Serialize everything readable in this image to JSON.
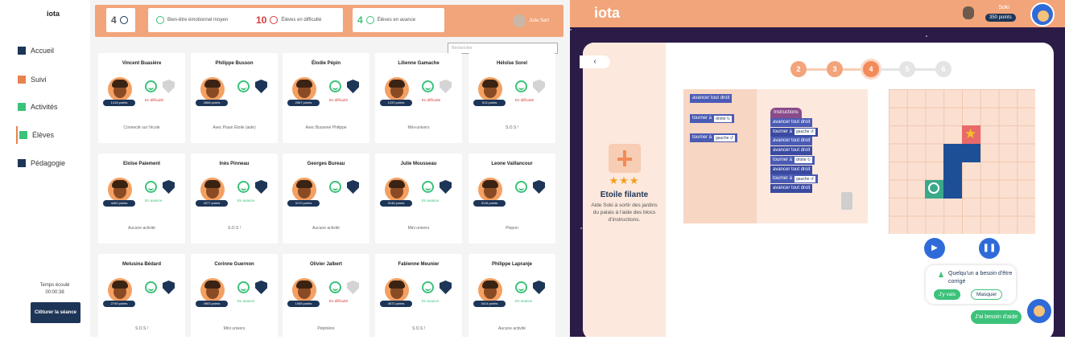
{
  "teacher": {
    "logo": "iota",
    "nav": [
      {
        "label": "Accueil",
        "icon": "calendar-icon",
        "color": "#1d3557"
      },
      {
        "label": "Suivi",
        "icon": "bar-chart-icon",
        "color": "#e8834f"
      },
      {
        "label": "Activités",
        "icon": "activities-icon",
        "color": "#3cc27a"
      },
      {
        "label": "Élèves",
        "icon": "students-icon",
        "color": "#3cc27a"
      },
      {
        "label": "Pédagogie",
        "icon": "book-icon",
        "color": "#1d3557"
      }
    ],
    "time_label": "Temps écoulé",
    "time_value": "00:00:38",
    "end_button": "Clôturer la séance",
    "stats": [
      {
        "value": "4",
        "text": "",
        "icon": "bell-icon"
      },
      {
        "value": "",
        "text": "Bien-être émotionnel moyen",
        "icon": "smile-icon"
      },
      {
        "value": "10",
        "text": "Élèves en difficulté",
        "icon": "arrow-icon"
      },
      {
        "value": "4",
        "text": "Élèves en avance",
        "icon": "arrow-icon"
      }
    ],
    "user_name": "Julie Sart",
    "search_placeholder": "Rechercher",
    "students": [
      {
        "name": "Vincent Buasière",
        "points": "1418 points",
        "status": "En difficulté",
        "activity": "Connecté sur l'école"
      },
      {
        "name": "Philippe Busson",
        "points": "2868 points",
        "status": "",
        "activity": "Avec Piaan Étoile (aide)"
      },
      {
        "name": "Élodie Pépin",
        "points": "2567 points",
        "status": "En difficulté",
        "activity": "Avec Bussené Philippe"
      },
      {
        "name": "Lilienne Gamache",
        "points": "1220 points",
        "status": "En difficulté",
        "activity": "Mini-univers"
      },
      {
        "name": "Héloïse Sorel",
        "points": "513 points",
        "status": "En difficulté",
        "activity": "S.O.S !"
      },
      {
        "name": "Eloïse Paiement",
        "points": "4462 points",
        "status": "En avance",
        "activity": "Aucune activité"
      },
      {
        "name": "Inès Pinneau",
        "points": "4377 points",
        "status": "En avance",
        "activity": "S.O.S !"
      },
      {
        "name": "Georges Bureau",
        "points": "3170 points",
        "status": "",
        "activity": "Aucune activité"
      },
      {
        "name": "Julie Mousseau",
        "points": "3146 points",
        "status": "En avance",
        "activity": "Mini univers"
      },
      {
        "name": "Leone Vaillancour",
        "points": "3115 points",
        "status": "",
        "activity": "Pinpon"
      },
      {
        "name": "Melusina Bédard",
        "points": "2749 points",
        "status": "",
        "activity": "S.O.S !"
      },
      {
        "name": "Corinne Guernon",
        "points": "4963 points",
        "status": "En avance",
        "activity": "Mini univers"
      },
      {
        "name": "Olivier Jalbert",
        "points": "1068 points",
        "status": "En difficulté",
        "activity": "Pépinière"
      },
      {
        "name": "Fabienne Meunier",
        "points": "4672 points",
        "status": "En avance",
        "activity": "S.O.S !"
      },
      {
        "name": "Philippe Lapranje",
        "points": "4414 points",
        "status": "En avance",
        "activity": "Aucune activité"
      }
    ]
  },
  "app": {
    "brand": "iota",
    "user_name": "Soki",
    "points": "350 points",
    "back_label": "‹",
    "level": {
      "title": "Etoile filante",
      "description": "Aide Soki à sortir des jardins du palais à l'aide des blocs d'instructions.",
      "stars": "★★★"
    },
    "steps": [
      {
        "n": "2",
        "state": "done"
      },
      {
        "n": "3",
        "state": "done"
      },
      {
        "n": "4",
        "state": "current"
      },
      {
        "n": "5",
        "state": "todo"
      },
      {
        "n": "6",
        "state": "todo"
      }
    ],
    "palette": {
      "forward": "avancer tout droit",
      "turn": "tourner à",
      "right": "droite ↻",
      "left": "gauche ↺"
    },
    "program_header": "Instructions",
    "program": [
      {
        "text": "avancer tout droit",
        "dd": ""
      },
      {
        "text": "tourner à",
        "dd": "gauche ↺"
      },
      {
        "text": "avancer tout droit",
        "dd": ""
      },
      {
        "text": "avancer tout droit",
        "dd": ""
      },
      {
        "text": "tourner à",
        "dd": "droite ↻"
      },
      {
        "text": "avancer tout droit",
        "dd": ""
      },
      {
        "text": "tourner à",
        "dd": "gauche ↺"
      },
      {
        "text": "avancer tout droit",
        "dd": ""
      }
    ],
    "play_label": "▶",
    "pause_label": "❚❚",
    "notif": "Quelqu'un a besoin d'être corrigé",
    "go_label": "J'y vais",
    "hide_label": "Masquer",
    "help_label": "J'ai besoin d'aide",
    "colors": {
      "accent": "#f2a47a",
      "navy": "#1d3557",
      "green": "#3cc27a",
      "blue": "#2f6bd8"
    }
  }
}
